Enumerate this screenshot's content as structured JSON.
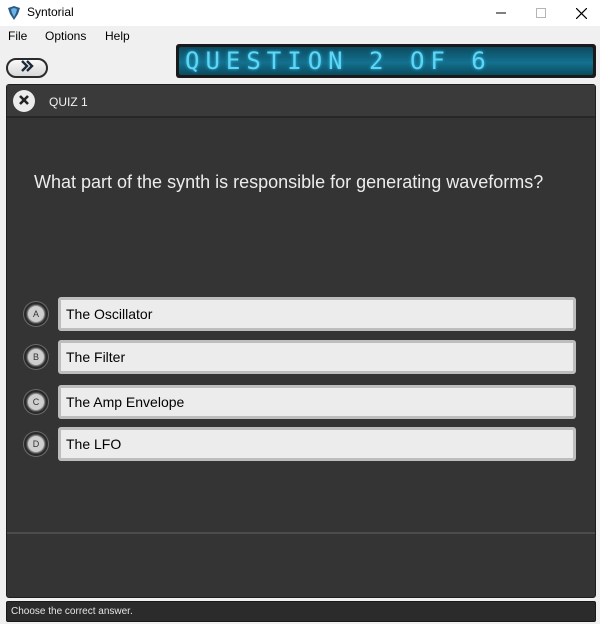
{
  "window": {
    "title": "Syntorial"
  },
  "menu": [
    "File",
    "Options",
    "Help"
  ],
  "lcd": {
    "text": "QUESTION 2 OF 6"
  },
  "quiz": {
    "label": "QUIZ 1",
    "question": "What part of the synth is responsible for generating waveforms?",
    "options": [
      {
        "letter": "A",
        "text": "The Oscillator"
      },
      {
        "letter": "B",
        "text": "The Filter"
      },
      {
        "letter": "C",
        "text": "The Amp Envelope"
      },
      {
        "letter": "D",
        "text": "The LFO"
      }
    ]
  },
  "status": {
    "text": "Choose the correct answer."
  },
  "icons": {
    "app": "syntorial-logo-icon",
    "next": "double-chevron-right-icon",
    "close": "close-x-icon"
  },
  "colors": {
    "lcd_text": "#5fd6f5",
    "lcd_bg": "#13718f",
    "panel": "#343434"
  }
}
